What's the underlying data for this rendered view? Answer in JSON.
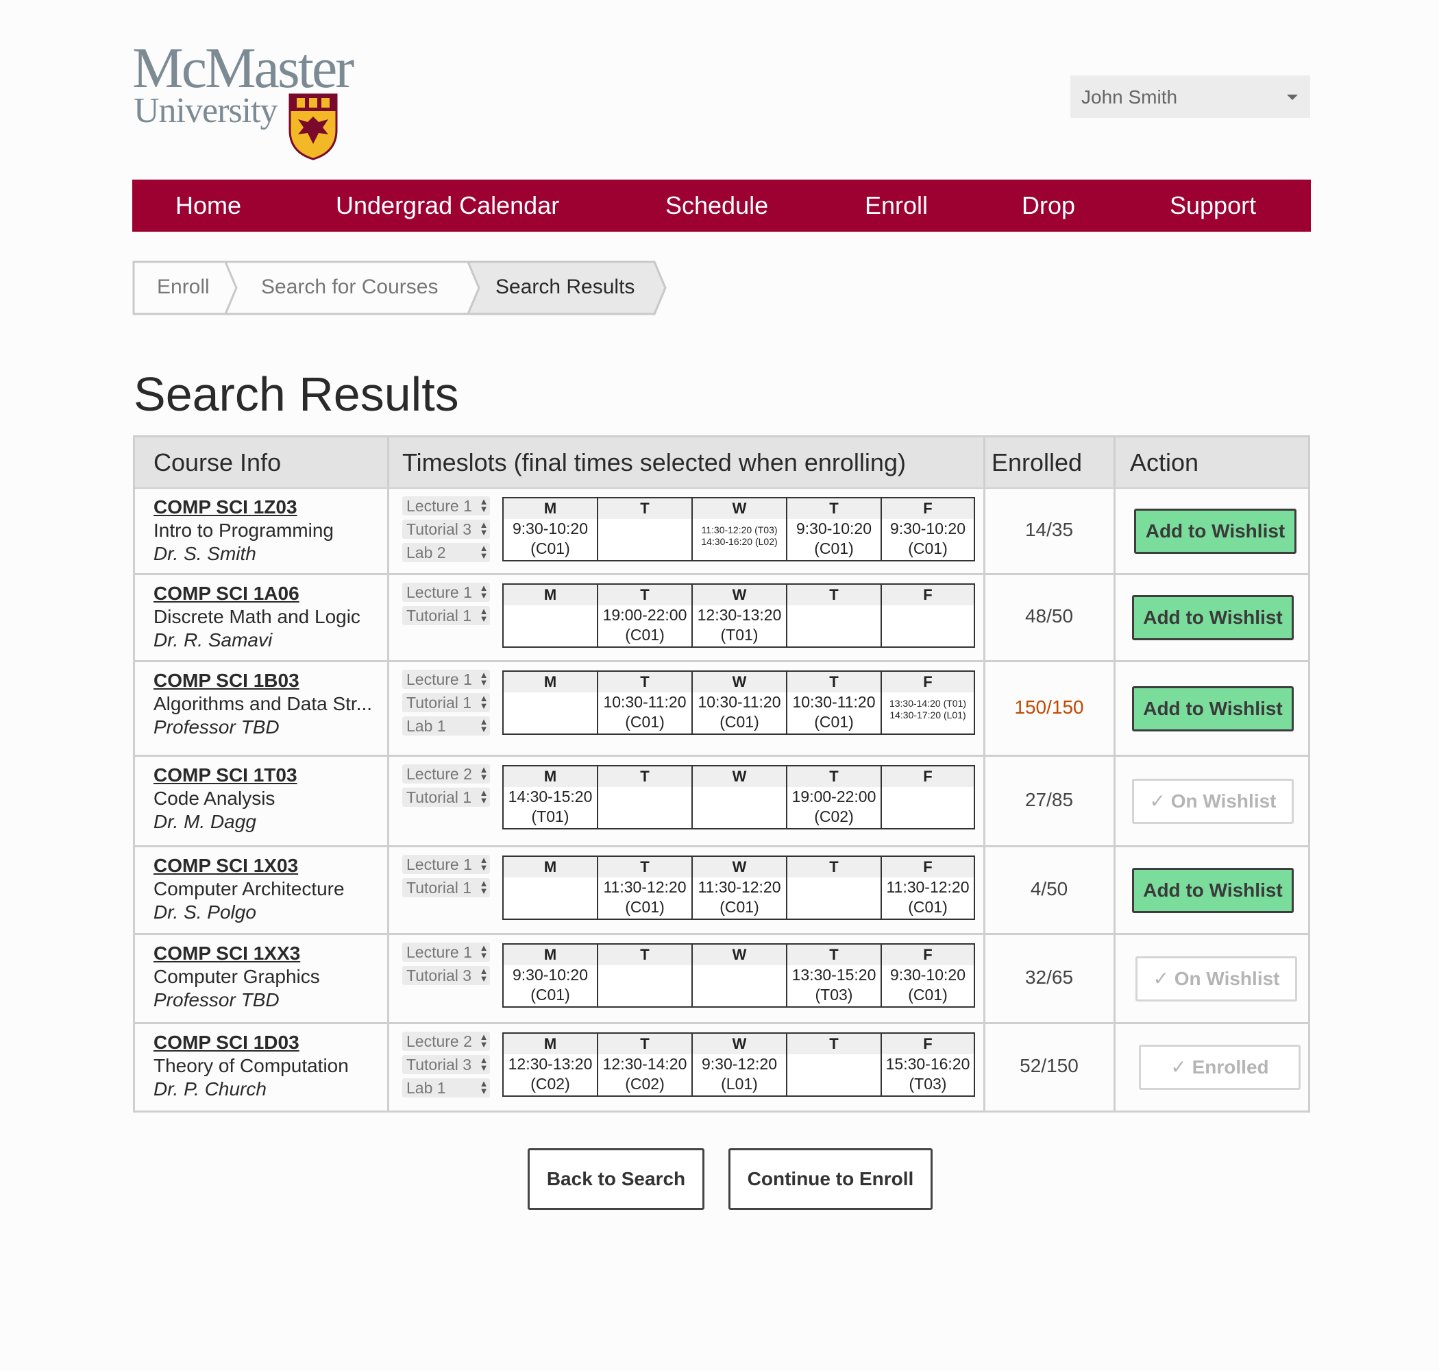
{
  "header": {
    "logo_line1": "McMaster",
    "logo_line2": "University",
    "user": "John Smith"
  },
  "nav": [
    "Home",
    "Undergrad Calendar",
    "Schedule",
    "Enroll",
    "Drop",
    "Support"
  ],
  "breadcrumb": [
    "Enroll",
    "Search for Courses",
    "Search Results"
  ],
  "page_title": "Search Results",
  "table": {
    "headers": [
      "Course Info",
      "Timeslots (final times selected when enrolling)",
      "Enrolled",
      "Action"
    ],
    "days": [
      "M",
      "T",
      "W",
      "T",
      "F"
    ],
    "rows": [
      {
        "code": "COMP SCI 1Z03",
        "title": "Intro to Programming",
        "instructor": "Dr. S. Smith",
        "components": [
          "Lecture 1",
          "Tutorial 3",
          "Lab 2"
        ],
        "slots": [
          [
            "9:30-10:20",
            "(C01)"
          ],
          [],
          [
            "11:30-12:20 (T03)",
            "14:30-16:20 (L02)"
          ],
          [
            "9:30-10:20",
            "(C01)"
          ],
          [
            "9:30-10:20",
            "(C01)"
          ]
        ],
        "small": [
          false,
          false,
          true,
          false,
          false
        ],
        "enrolled": "14/35",
        "action": "Add to Wishlist"
      },
      {
        "code": "COMP SCI 1A06",
        "title": "Discrete Math and Logic",
        "instructor": "Dr. R. Samavi",
        "components": [
          "Lecture 1",
          "Tutorial 1"
        ],
        "slots": [
          [],
          [
            "19:00-22:00",
            "(C01)"
          ],
          [
            "12:30-13:20",
            "(T01)"
          ],
          [],
          []
        ],
        "small": [
          false,
          false,
          false,
          false,
          false
        ],
        "enrolled": "48/50",
        "action": "Add to Wishlist"
      },
      {
        "code": "COMP SCI 1B03",
        "title": "Algorithms and Data Str...",
        "instructor": "Professor TBD",
        "components": [
          "Lecture 1",
          "Tutorial 1",
          "Lab 1"
        ],
        "slots": [
          [],
          [
            "10:30-11:20",
            "(C01)"
          ],
          [
            "10:30-11:20",
            "(C01)"
          ],
          [
            "10:30-11:20",
            "(C01)"
          ],
          [
            "13:30-14:20 (T01)",
            "14:30-17:20 (L01)"
          ]
        ],
        "small": [
          false,
          false,
          false,
          false,
          true
        ],
        "enrolled": "150/150",
        "enrolled_full": true,
        "action": "Add to Wishlist"
      },
      {
        "code": "COMP SCI 1T03",
        "title": "Code Analysis",
        "instructor": "Dr. M. Dagg",
        "components": [
          "Lecture 2",
          "Tutorial 1"
        ],
        "slots": [
          [
            "14:30-15:20",
            "(T01)"
          ],
          [],
          [],
          [
            "19:00-22:00",
            "(C02)"
          ],
          []
        ],
        "small": [
          false,
          false,
          false,
          false,
          false
        ],
        "enrolled": "27/85",
        "action": "✓ On Wishlist"
      },
      {
        "code": "COMP SCI 1X03",
        "title": "Computer Architecture",
        "instructor": "Dr. S. Polgo",
        "components": [
          "Lecture 1",
          "Tutorial 1"
        ],
        "slots": [
          [],
          [
            "11:30-12:20",
            "(C01)"
          ],
          [
            "11:30-12:20",
            "(C01)"
          ],
          [],
          [
            "11:30-12:20",
            "(C01)"
          ]
        ],
        "small": [
          false,
          false,
          false,
          false,
          false
        ],
        "enrolled": "4/50",
        "action": "Add to Wishlist"
      },
      {
        "code": "COMP SCI 1XX3",
        "title": "Computer Graphics",
        "instructor": "Professor TBD",
        "components": [
          "Lecture 1",
          "Tutorial 3"
        ],
        "slots": [
          [
            "9:30-10:20",
            "(C01)"
          ],
          [],
          [],
          [
            "13:30-15:20",
            "(T03)"
          ],
          [
            "9:30-10:20",
            "(C01)"
          ]
        ],
        "small": [
          false,
          false,
          false,
          false,
          false
        ],
        "enrolled": "32/65",
        "action": "✓ On Wishlist"
      },
      {
        "code": "COMP SCI 1D03",
        "title": "Theory of Computation",
        "instructor": "Dr. P. Church",
        "components": [
          "Lecture 2",
          "Tutorial 3",
          "Lab 1"
        ],
        "slots": [
          [
            "12:30-13:20",
            "(C02)"
          ],
          [
            "12:30-14:20",
            "(C02)"
          ],
          [
            "9:30-12:20",
            "(L01)"
          ],
          [],
          [
            "15:30-16:20",
            "(T03)"
          ]
        ],
        "small": [
          false,
          false,
          false,
          false,
          false
        ],
        "enrolled": "52/150",
        "action": "✓ Enrolled"
      }
    ]
  },
  "buttons": {
    "back": "Back to Search",
    "continue": "Continue to Enroll"
  },
  "colors": {
    "brand": "#9c0132",
    "wishlist_green": "#7bdd9c",
    "full_orange": "#c04a00"
  }
}
